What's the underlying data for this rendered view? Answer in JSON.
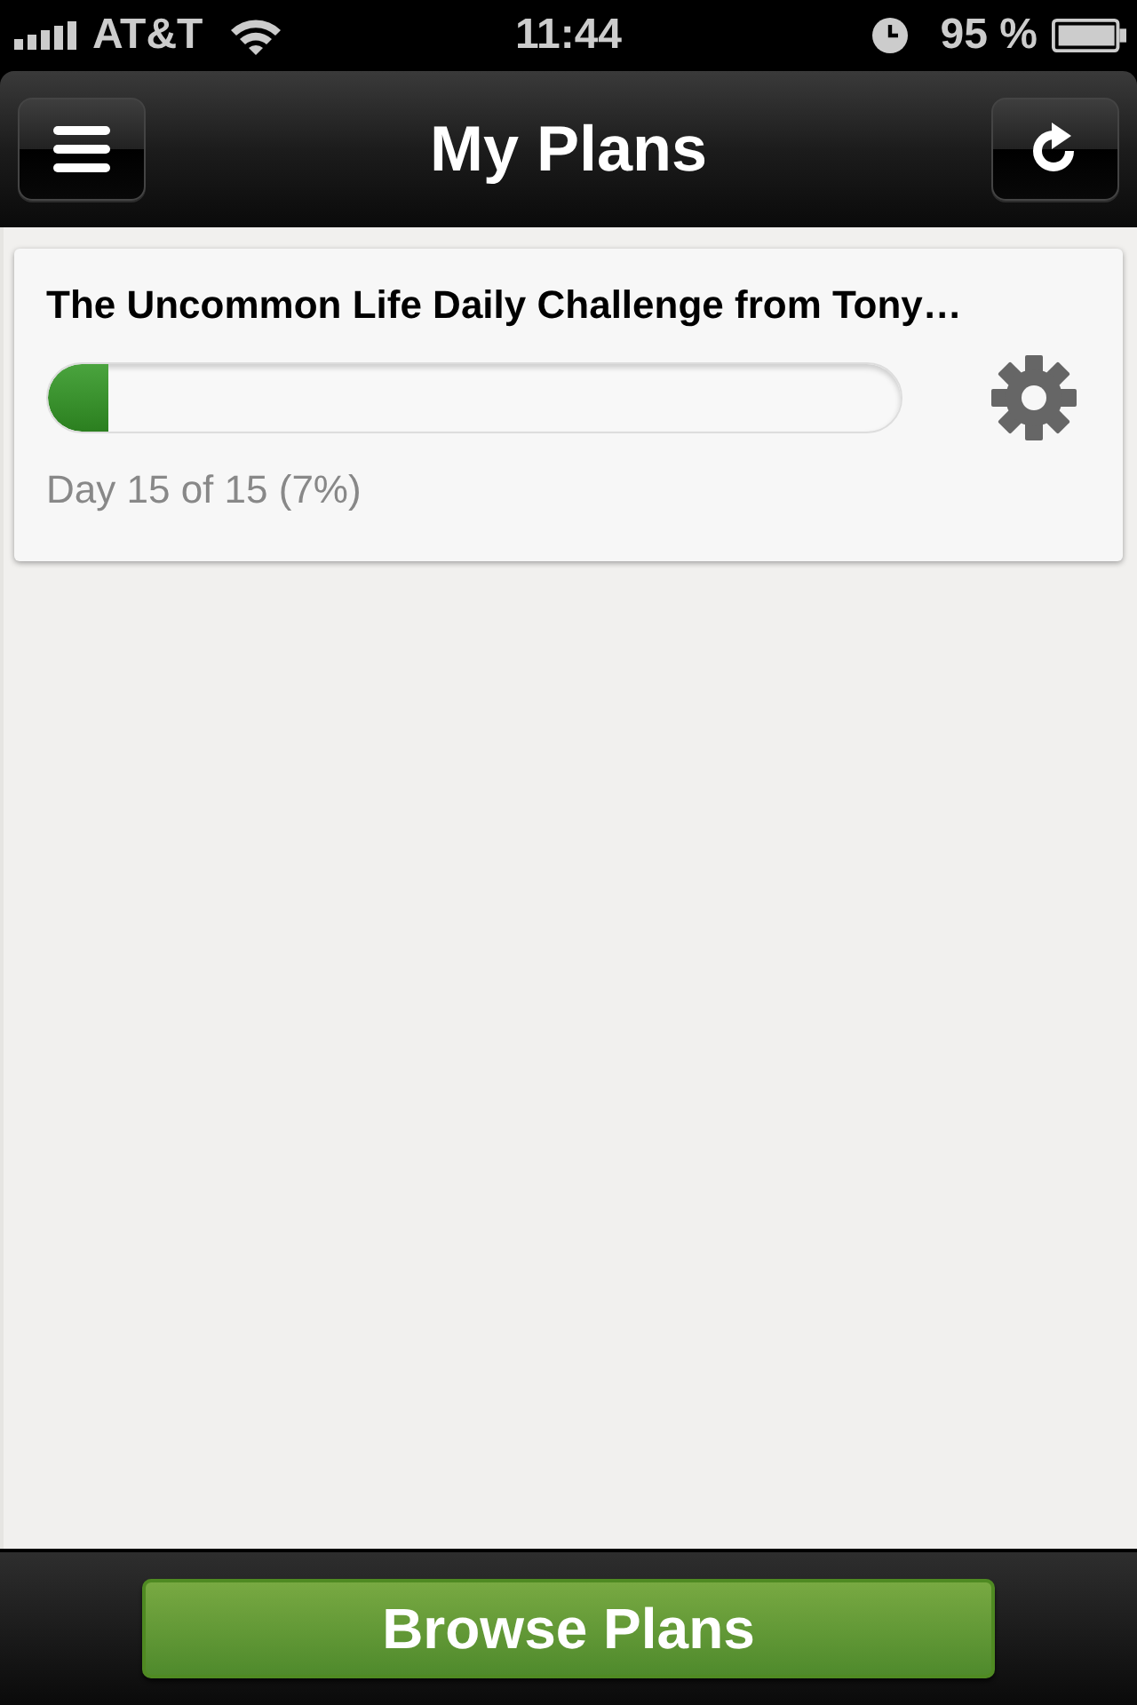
{
  "status_bar": {
    "carrier": "AT&T",
    "time": "11:44",
    "battery": "95 %"
  },
  "nav_bar": {
    "title": "My Plans"
  },
  "plans": [
    {
      "title": "The Uncommon Life Daily Challenge from Tony…",
      "level": 0.07,
      "progress_text": "Day 15 of 15 (7%)"
    }
  ],
  "bottom_bar": {
    "button": "Browse Plans"
  }
}
